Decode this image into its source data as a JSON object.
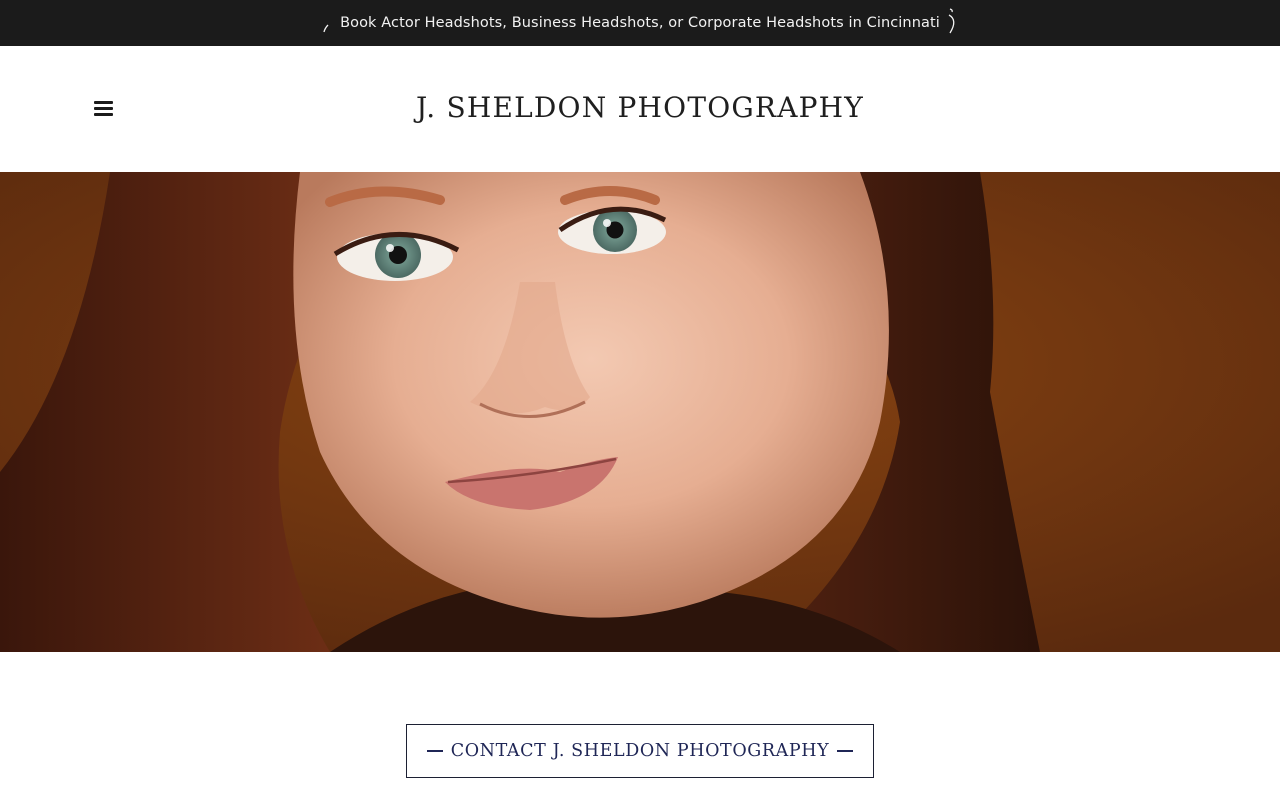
{
  "announcement": {
    "text": "Book Actor Headshots, Business Headshots, or Corporate Headshots in Cincinnati"
  },
  "header": {
    "site_title": "J. SHELDON PHOTOGRAPHY",
    "menu_icon": "hamburger-menu-icon"
  },
  "hero": {
    "image_description_icon": "hero-photo"
  },
  "contact": {
    "label": "CONTACT J. SHELDON PHOTOGRAPHY"
  },
  "colors": {
    "announcement_bg": "#1b1b1b",
    "announcement_text": "#f2f2f2",
    "title_text": "#1f1f1f",
    "accent_navy": "#1f2656",
    "hero_bg": "#6f330e"
  }
}
